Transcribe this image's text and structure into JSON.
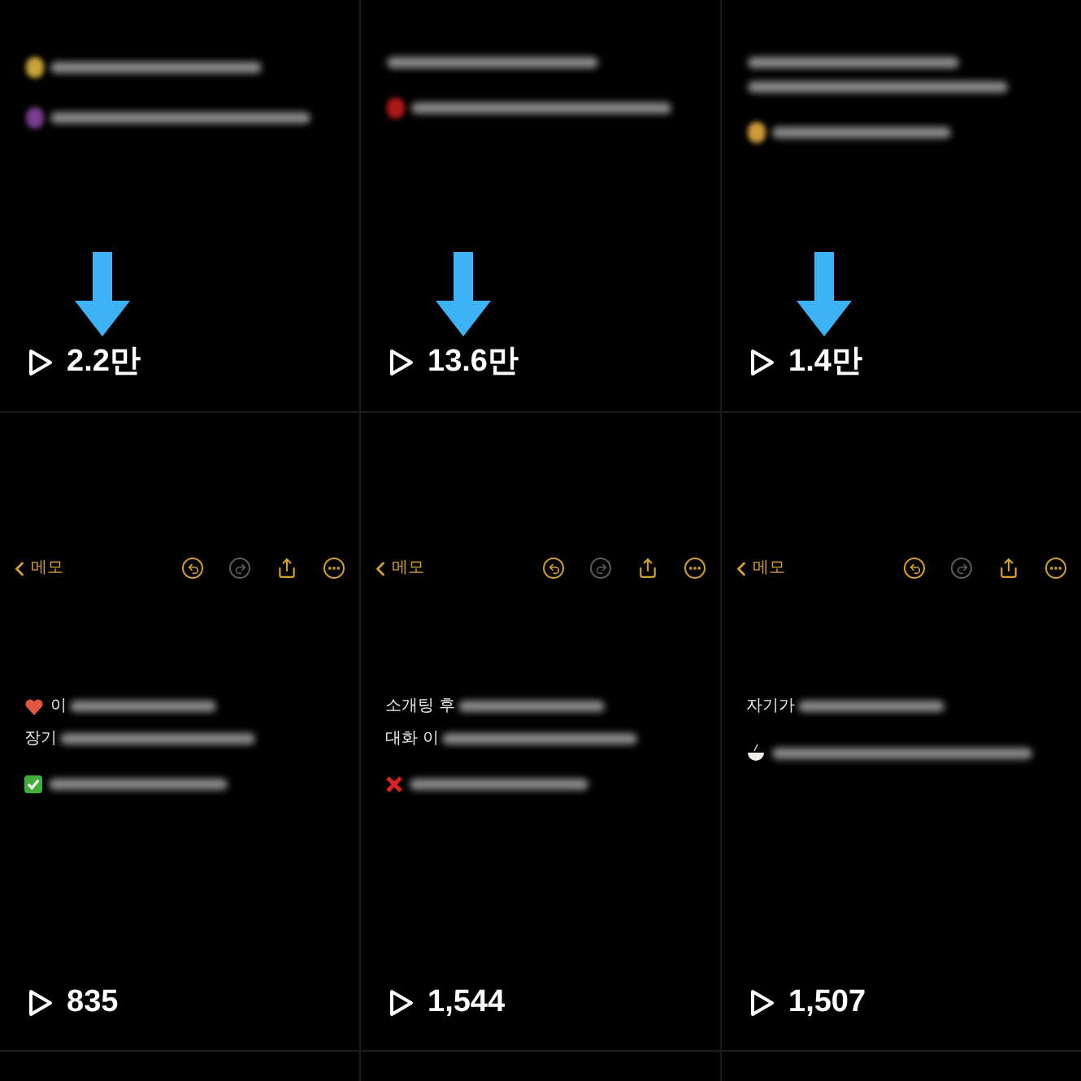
{
  "tiles": [
    {
      "kind": "blurred",
      "arrow": true,
      "views": "2.2만",
      "lines": [
        {
          "kind": "blob",
          "color": "#c9a43a"
        },
        {
          "kind": "blob",
          "color": "#7a3f8f"
        }
      ]
    },
    {
      "kind": "blurred",
      "arrow": true,
      "views": "13.6만",
      "lines": [
        {
          "kind": "plain"
        },
        {
          "kind": "blob",
          "color": "#b01818"
        }
      ]
    },
    {
      "kind": "blurred",
      "arrow": true,
      "views": "1.4만",
      "lines": [
        {
          "kind": "plain"
        },
        {
          "kind": "plain"
        },
        {
          "kind": "blob",
          "color": "#d09a3a"
        }
      ]
    },
    {
      "kind": "memo",
      "arrow": false,
      "views": "835",
      "back_label": "메모",
      "toolbar": [
        {
          "kind": "undo",
          "disabled": false
        },
        {
          "kind": "redo",
          "disabled": true
        },
        {
          "kind": "share",
          "disabled": false
        },
        {
          "kind": "more",
          "disabled": false
        }
      ],
      "lines": [
        {
          "kind": "heart",
          "text": "이"
        },
        {
          "kind": "plain",
          "text": "장기"
        },
        {
          "kind": "check"
        }
      ]
    },
    {
      "kind": "memo",
      "arrow": false,
      "views": "1,544",
      "back_label": "메모",
      "toolbar": [
        {
          "kind": "undo",
          "disabled": false
        },
        {
          "kind": "redo",
          "disabled": true
        },
        {
          "kind": "share",
          "disabled": false
        },
        {
          "kind": "more",
          "disabled": false
        }
      ],
      "lines": [
        {
          "kind": "plain",
          "text": "소개팅 후"
        },
        {
          "kind": "plain",
          "text": "대화 이"
        },
        {
          "kind": "cross"
        }
      ]
    },
    {
      "kind": "memo",
      "arrow": false,
      "views": "1,507",
      "back_label": "메모",
      "toolbar": [
        {
          "kind": "undo",
          "disabled": false
        },
        {
          "kind": "redo",
          "disabled": true
        },
        {
          "kind": "share",
          "disabled": false
        },
        {
          "kind": "more",
          "disabled": false
        }
      ],
      "lines": [
        {
          "kind": "plain",
          "text": "자기가"
        },
        {
          "kind": "bowl"
        }
      ]
    }
  ]
}
